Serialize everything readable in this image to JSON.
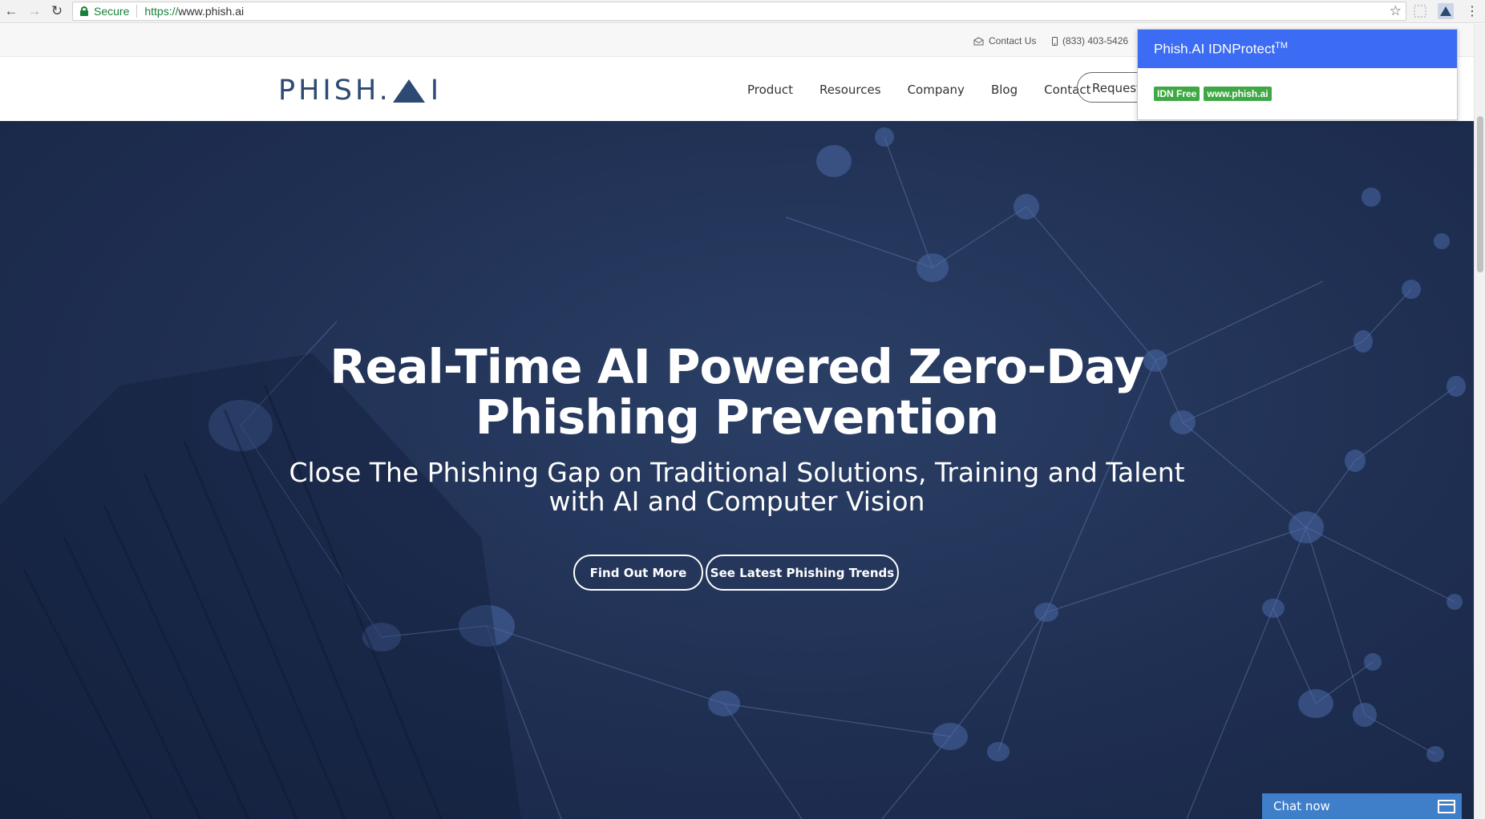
{
  "browser": {
    "secure_label": "Secure",
    "url_scheme": "https://",
    "url_host": "www.phish.ai",
    "icons": [
      "back-icon",
      "forward-icon",
      "reload-icon",
      "lock-icon",
      "star-icon",
      "extension-icon",
      "phishai-extension-icon",
      "menu-icon"
    ]
  },
  "topbar": {
    "contact_label": "Contact Us",
    "phone": "(833) 403-5426"
  },
  "header": {
    "logo_left": "PHISH.",
    "logo_right": "I",
    "nav": [
      "Product",
      "Resources",
      "Company",
      "Blog",
      "Contact"
    ],
    "request_label": "Request"
  },
  "hero": {
    "title_line1": "Real-Time AI Powered Zero-Day",
    "title_line2": "Phishing Prevention",
    "subtitle_line1": "Close The Phishing Gap on Traditional Solutions, Training and Talent",
    "subtitle_line2": "with AI and Computer Vision",
    "buttons": [
      "Find Out More",
      "See Latest Phishing Trends"
    ]
  },
  "popup": {
    "title": "Phish.AI IDNProtect",
    "title_sup": "TM",
    "badges": [
      "IDN Free",
      "www.phish.ai"
    ]
  },
  "chat": {
    "label": "Chat now"
  },
  "colors": {
    "brand": "#2c4a73",
    "popup_header": "#3c6cf4",
    "badge": "#3fa845",
    "chat": "#3f7fc9",
    "hero": "#1f2f52"
  }
}
